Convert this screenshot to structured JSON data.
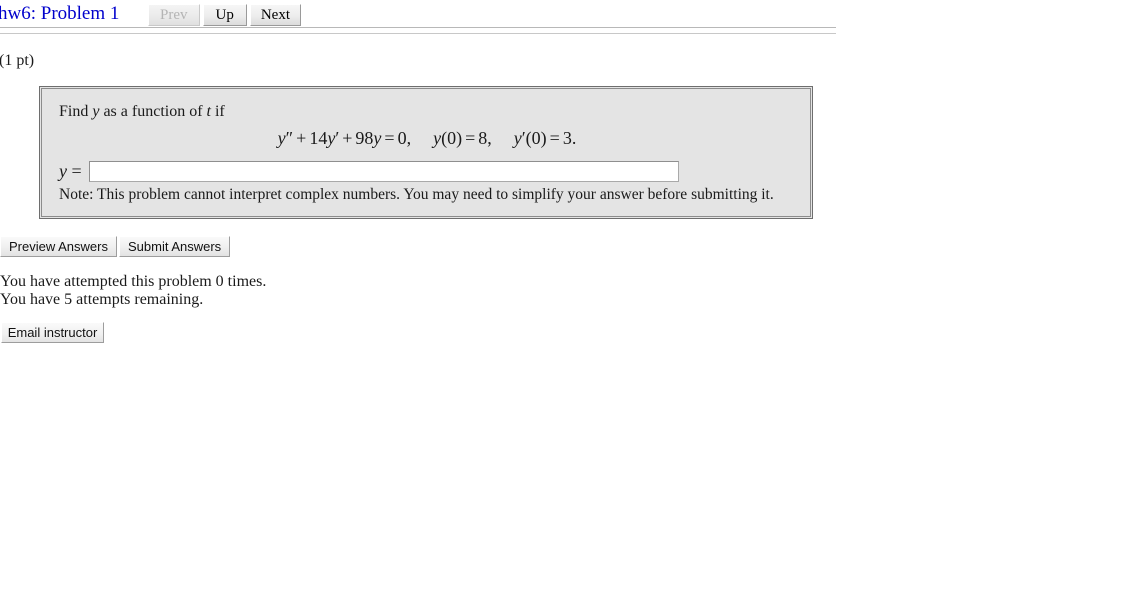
{
  "header": {
    "title": "hw6: Problem 1",
    "title_color": "#0000cc",
    "nav": {
      "prev_label": "Prev",
      "up_label": "Up",
      "next_label": "Next"
    }
  },
  "points": "(1 pt)",
  "problem": {
    "prompt_prefix": "Find",
    "prompt_var": "y",
    "prompt_middle": "as a function of",
    "prompt_var2": "t",
    "prompt_suffix": "if",
    "equation": {
      "lhs_y": "y",
      "lhs_primes": "″",
      "plus1": "+",
      "coef1": "14",
      "y2": "y",
      "prime2": "′",
      "plus2": "+",
      "coef2": "98",
      "y3": "y",
      "equals1": "=",
      "rhs1": "0,",
      "ic1_y": "y",
      "ic1_arg": "(0)",
      "ic1_equals": "=",
      "ic1_value": "8,",
      "ic2_y": "y",
      "ic2_prime": "′",
      "ic2_arg": "(0)",
      "ic2_equals": "=",
      "ic2_value": "3."
    },
    "answer": {
      "label_var": "y",
      "label_equals": "=",
      "value": "",
      "placeholder": ""
    },
    "note": "Note: This problem cannot interpret complex numbers. You may need to simplify your answer before submitting it."
  },
  "actions": {
    "preview_label": "Preview Answers",
    "submit_label": "Submit Answers"
  },
  "status": {
    "attempted": "You have attempted this problem 0 times.",
    "remaining": "You have 5 attempts remaining."
  },
  "footer": {
    "email_label": "Email instructor"
  }
}
